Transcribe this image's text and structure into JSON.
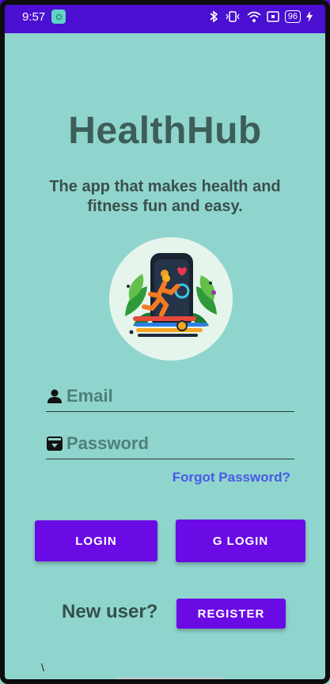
{
  "status_bar": {
    "time": "9:57",
    "battery": "96"
  },
  "app": {
    "title": "HealthHub",
    "tagline": "The app that makes health and fitness fun and easy."
  },
  "form": {
    "email_placeholder": "Email",
    "password_placeholder": "Password",
    "forgot_password": "Forgot Password?",
    "login_label": "LOGIN",
    "google_login_label": "G LOGIN",
    "new_user_text": "New user?",
    "register_label": "REGISTER",
    "stray_text": "\\"
  },
  "colors": {
    "background": "#8fd5cd",
    "status_bar": "#4a0fd0",
    "button": "#6a0be6",
    "link": "#4b58e6",
    "title": "#3d5e58"
  },
  "icons": {
    "email_field_icon": "person-icon",
    "password_field_icon": "archive-box-icon"
  }
}
